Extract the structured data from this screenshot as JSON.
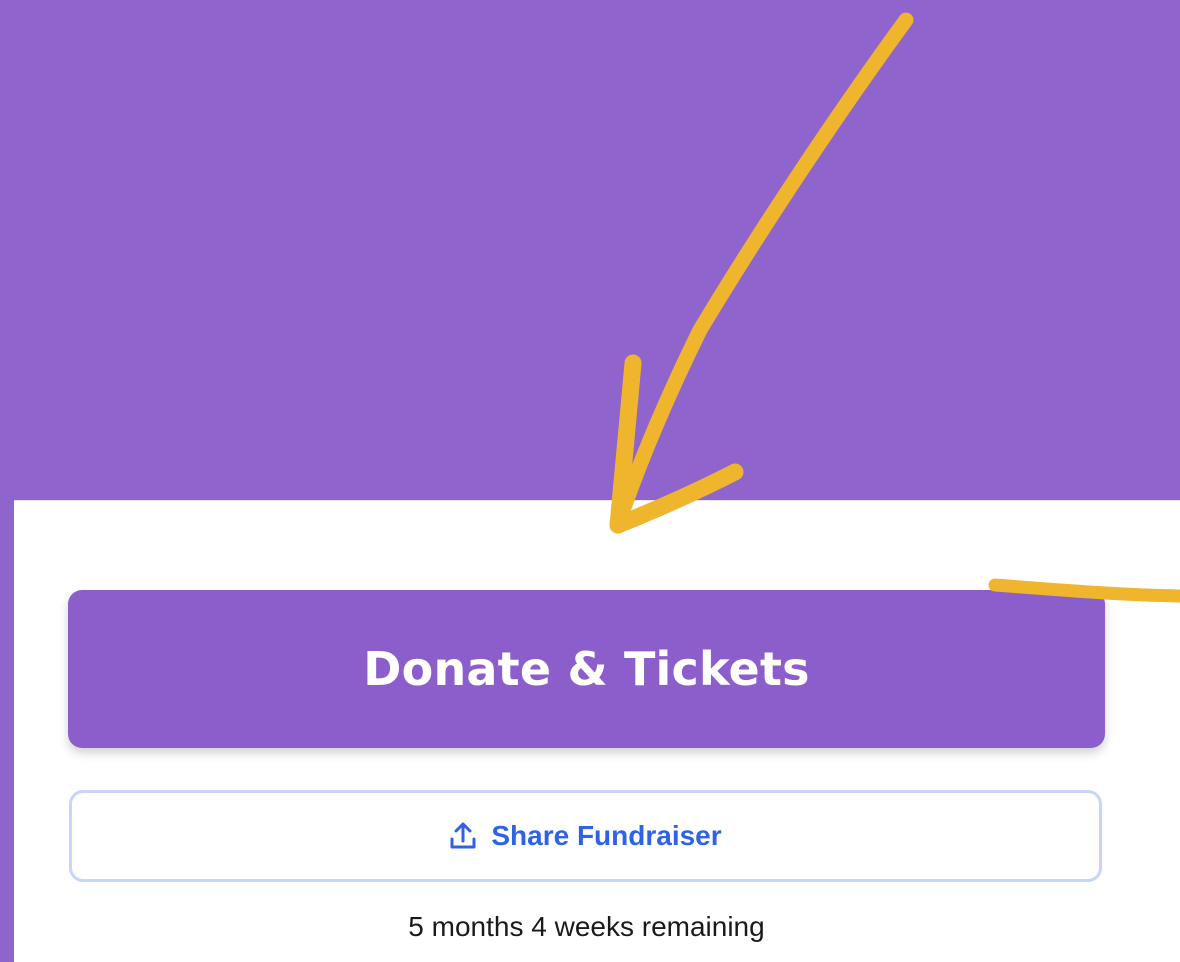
{
  "buttons": {
    "donate_label": "Donate & Tickets",
    "share_label": "Share Fundraiser"
  },
  "status": {
    "time_remaining": "5 months 4 weeks remaining"
  },
  "icons": {
    "share": "share-upload-icon"
  },
  "colors": {
    "background_purple": "#8f64cc",
    "donate_button": "#8c5ecb",
    "share_text": "#2f62e6",
    "share_border": "#c6d5fb",
    "annotation": "#efb52c"
  }
}
